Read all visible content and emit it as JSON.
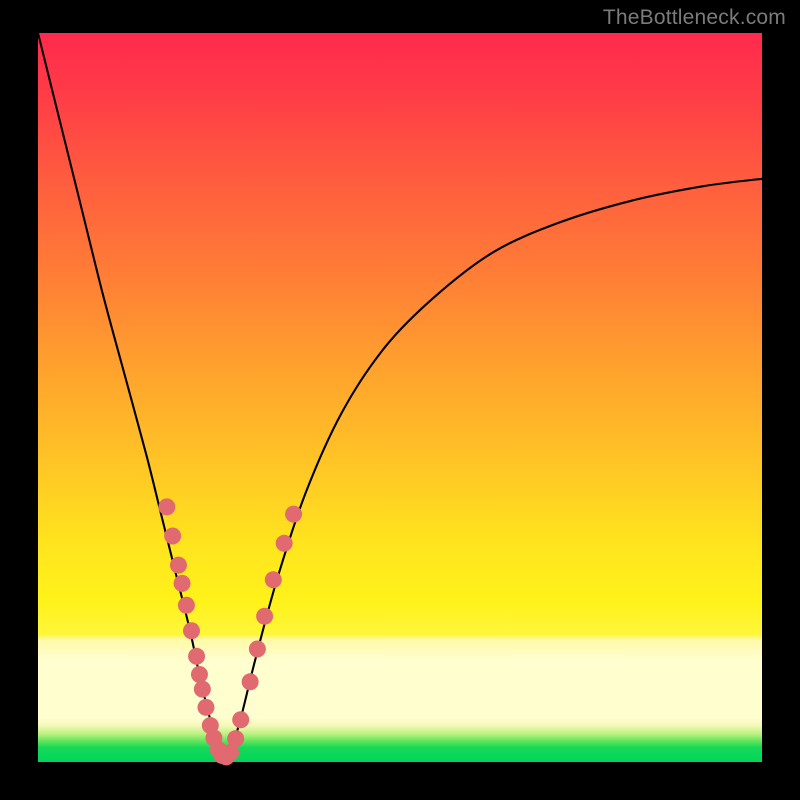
{
  "watermark": "TheBottleneck.com",
  "colors": {
    "frame": "#000000",
    "dot": "#e06a6f",
    "curve": "#000000",
    "gradient_top": "#ff2a4d",
    "gradient_bottom": "#00d65a"
  },
  "chart_data": {
    "type": "line",
    "title": "",
    "xlabel": "",
    "ylabel": "",
    "xlim": [
      0,
      100
    ],
    "ylim": [
      0,
      100
    ],
    "grid": false,
    "series": [
      {
        "name": "bottleneck-curve",
        "x": [
          0,
          3,
          6,
          9,
          12,
          15,
          17,
          19,
          21,
          22.5,
          24,
          25,
          25.7,
          26.5,
          28,
          30,
          33,
          37,
          42,
          48,
          55,
          63,
          72,
          82,
          92,
          100
        ],
        "y": [
          100,
          88,
          76,
          64,
          53,
          42,
          34,
          26,
          18,
          11,
          5,
          1.5,
          0.5,
          1.2,
          6,
          14,
          25,
          37,
          48,
          57,
          64,
          70,
          74,
          77,
          79,
          80
        ]
      }
    ],
    "dots": {
      "name": "sample-points",
      "points": [
        {
          "x": 17.8,
          "y": 35
        },
        {
          "x": 18.6,
          "y": 31
        },
        {
          "x": 19.4,
          "y": 27
        },
        {
          "x": 19.9,
          "y": 24.5
        },
        {
          "x": 20.5,
          "y": 21.5
        },
        {
          "x": 21.2,
          "y": 18
        },
        {
          "x": 21.9,
          "y": 14.5
        },
        {
          "x": 22.3,
          "y": 12
        },
        {
          "x": 22.7,
          "y": 10
        },
        {
          "x": 23.2,
          "y": 7.5
        },
        {
          "x": 23.8,
          "y": 5
        },
        {
          "x": 24.3,
          "y": 3.3
        },
        {
          "x": 24.9,
          "y": 1.7
        },
        {
          "x": 25.4,
          "y": 0.9
        },
        {
          "x": 26.0,
          "y": 0.7
        },
        {
          "x": 26.6,
          "y": 1.3
        },
        {
          "x": 27.3,
          "y": 3.2
        },
        {
          "x": 28.0,
          "y": 5.8
        },
        {
          "x": 29.3,
          "y": 11
        },
        {
          "x": 30.3,
          "y": 15.5
        },
        {
          "x": 31.3,
          "y": 20
        },
        {
          "x": 32.5,
          "y": 25
        },
        {
          "x": 34.0,
          "y": 30
        },
        {
          "x": 35.3,
          "y": 34
        }
      ]
    }
  }
}
